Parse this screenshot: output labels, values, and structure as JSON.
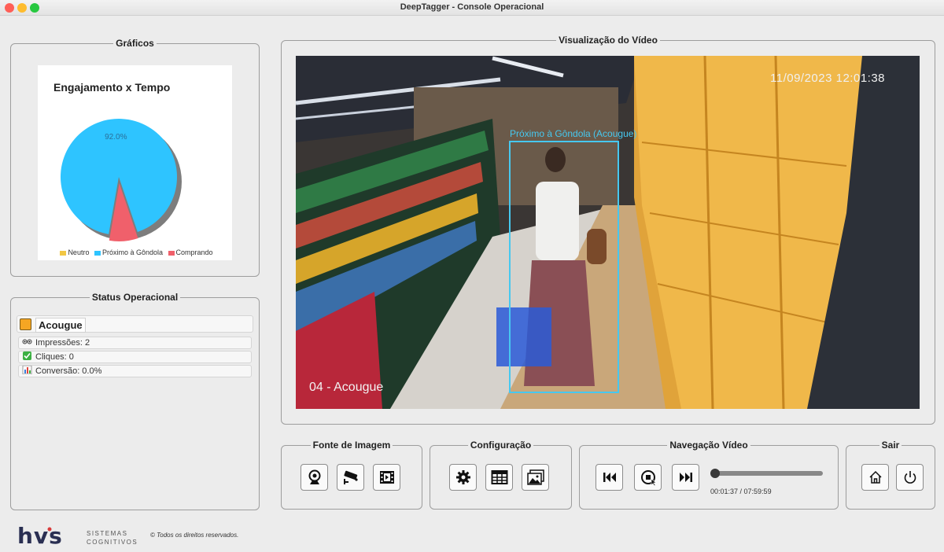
{
  "window": {
    "title": "DeepTagger - Console Operacional"
  },
  "groups": {
    "graphs": "Gráficos",
    "status": "Status Operacional",
    "video": "Visualização do Vídeo",
    "source": "Fonte de Imagem",
    "config": "Configuração",
    "nav": "Navegação Vídeo",
    "exit": "Sair"
  },
  "chart_data": {
    "type": "pie",
    "title": "Engajamento x Tempo",
    "categories": [
      "Neutro",
      "Próximo à Gôndola",
      "Comprando"
    ],
    "values": [
      0.0,
      92.0,
      8.0
    ],
    "colors": [
      "#f2c744",
      "#2ec4ff",
      "#f0606b"
    ],
    "labels": [
      "",
      "92.0%",
      ""
    ],
    "legend": "bottom",
    "exploded": "Comprando"
  },
  "status": {
    "zone": "Acougue",
    "zone_color": "#f5a623",
    "items": [
      {
        "icon": "eyes-icon",
        "text": "Impressões: 2"
      },
      {
        "icon": "check-icon",
        "text": "Cliques: 0"
      },
      {
        "icon": "bar-chart-icon",
        "text": "Conversão: 0.0%"
      }
    ]
  },
  "video": {
    "timestamp": "11/09/2023 12:01:38",
    "camera_label": "04 - Acougue",
    "detection_label": "Próximo à Gôndola (Acougue)",
    "detection_color": "#46c8f0"
  },
  "playback": {
    "progress": 0.0034,
    "time_display": "00:01:37 / 07:59:59"
  },
  "footer": {
    "logo": "hvs",
    "logo_sub": "SISTEMAS COGNITIVOS",
    "rights": "© Todos os direitos reservados."
  }
}
